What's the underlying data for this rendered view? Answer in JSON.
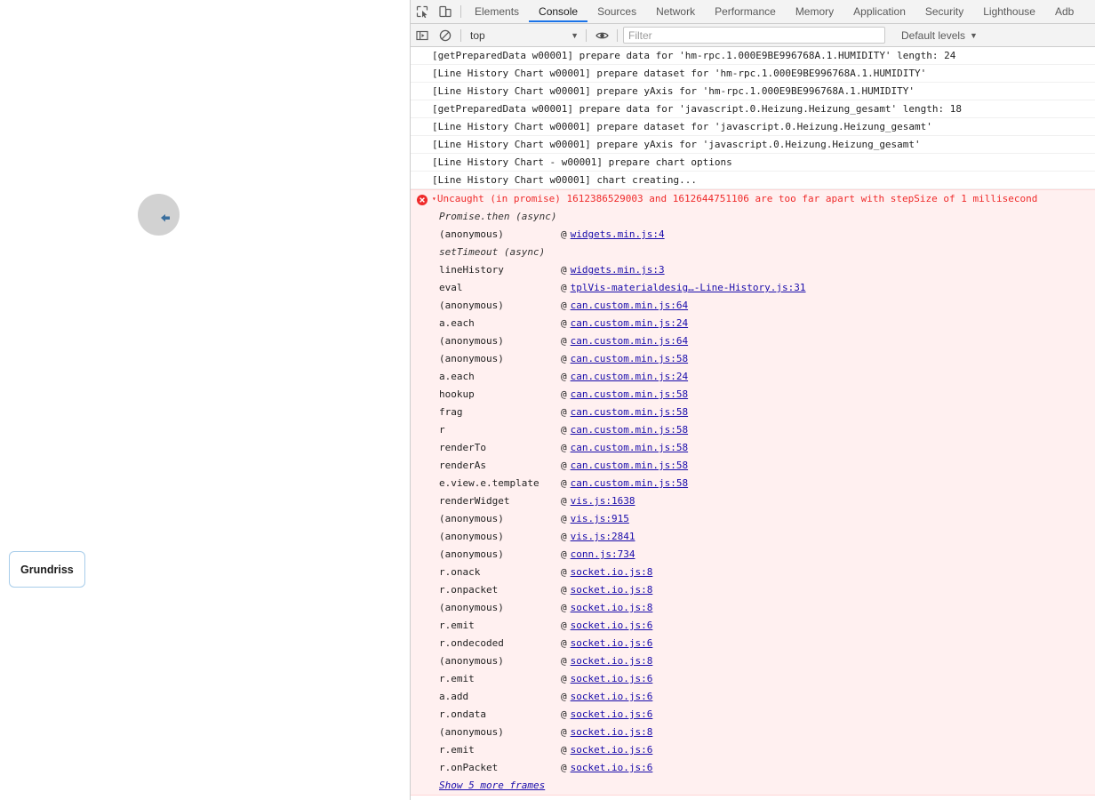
{
  "page": {
    "widget": {
      "circle_label": "",
      "cursor_icon": "cursor-arrow-icon"
    },
    "grundriss_button": "Grundriss"
  },
  "devtools": {
    "toolbar_icons": [
      {
        "name": "inspect-element-icon"
      },
      {
        "name": "device-toolbar-icon"
      }
    ],
    "tabs": [
      {
        "label": "Elements",
        "active": false
      },
      {
        "label": "Console",
        "active": true
      },
      {
        "label": "Sources",
        "active": false
      },
      {
        "label": "Network",
        "active": false
      },
      {
        "label": "Performance",
        "active": false
      },
      {
        "label": "Memory",
        "active": false
      },
      {
        "label": "Application",
        "active": false
      },
      {
        "label": "Security",
        "active": false
      },
      {
        "label": "Lighthouse",
        "active": false
      },
      {
        "label": "Adb",
        "active": false
      }
    ],
    "filterbar": {
      "sidebar_toggle_icon": "console-sidebar-icon",
      "clear_icon": "clear-console-icon",
      "context": "top",
      "context_caret": "▼",
      "eye_icon": "live-expression-eye-icon",
      "filter_placeholder": "Filter",
      "filter_value": "",
      "levels": "Default levels",
      "levels_caret": "▼"
    },
    "console": {
      "logs": [
        "[getPreparedData w00001] prepare data for 'hm-rpc.1.000E9BE996768A.1.HUMIDITY' length: 24",
        "[Line History Chart w00001] prepare dataset for 'hm-rpc.1.000E9BE996768A.1.HUMIDITY'",
        "[Line History Chart w00001] prepare yAxis for 'hm-rpc.1.000E9BE996768A.1.HUMIDITY'",
        "[getPreparedData w00001] prepare data for 'javascript.0.Heizung.Heizung_gesamt' length: 18",
        "[Line History Chart w00001] prepare dataset for 'javascript.0.Heizung.Heizung_gesamt'",
        "[Line History Chart w00001] prepare yAxis for 'javascript.0.Heizung.Heizung_gesamt'",
        "[Line History Chart - w00001] prepare chart options",
        "[Line History Chart w00001] chart creating..."
      ],
      "error": {
        "icon": "error-circle-icon",
        "triangle": "▾",
        "message": "Uncaught (in promise) 1612386529003 and 1612644751106 are too far apart with stepSize of 1 millisecond",
        "stack": [
          {
            "type": "async",
            "fn": "Promise.then (async)"
          },
          {
            "type": "frame",
            "fn": "(anonymous)",
            "at": "@",
            "link": "widgets.min.js:4"
          },
          {
            "type": "async",
            "fn": "setTimeout (async)"
          },
          {
            "type": "frame",
            "fn": "lineHistory",
            "at": "@",
            "link": "widgets.min.js:3"
          },
          {
            "type": "frame",
            "fn": "eval",
            "at": "@",
            "link": "tplVis-materialdesig…-Line-History.js:31"
          },
          {
            "type": "frame",
            "fn": "(anonymous)",
            "at": "@",
            "link": "can.custom.min.js:64"
          },
          {
            "type": "frame",
            "fn": "a.each",
            "at": "@",
            "link": "can.custom.min.js:24"
          },
          {
            "type": "frame",
            "fn": "(anonymous)",
            "at": "@",
            "link": "can.custom.min.js:64"
          },
          {
            "type": "frame",
            "fn": "(anonymous)",
            "at": "@",
            "link": "can.custom.min.js:58"
          },
          {
            "type": "frame",
            "fn": "a.each",
            "at": "@",
            "link": "can.custom.min.js:24"
          },
          {
            "type": "frame",
            "fn": "hookup",
            "at": "@",
            "link": "can.custom.min.js:58"
          },
          {
            "type": "frame",
            "fn": "frag",
            "at": "@",
            "link": "can.custom.min.js:58"
          },
          {
            "type": "frame",
            "fn": "r",
            "at": "@",
            "link": "can.custom.min.js:58"
          },
          {
            "type": "frame",
            "fn": "renderTo",
            "at": "@",
            "link": "can.custom.min.js:58"
          },
          {
            "type": "frame",
            "fn": "renderAs",
            "at": "@",
            "link": "can.custom.min.js:58"
          },
          {
            "type": "frame",
            "fn": "e.view.e.template",
            "at": "@",
            "link": "can.custom.min.js:58"
          },
          {
            "type": "frame",
            "fn": "renderWidget",
            "at": "@",
            "link": "vis.js:1638"
          },
          {
            "type": "frame",
            "fn": "(anonymous)",
            "at": "@",
            "link": "vis.js:915"
          },
          {
            "type": "frame",
            "fn": "(anonymous)",
            "at": "@",
            "link": "vis.js:2841"
          },
          {
            "type": "frame",
            "fn": "(anonymous)",
            "at": "@",
            "link": "conn.js:734"
          },
          {
            "type": "frame",
            "fn": "r.onack",
            "at": "@",
            "link": "socket.io.js:8"
          },
          {
            "type": "frame",
            "fn": "r.onpacket",
            "at": "@",
            "link": "socket.io.js:8"
          },
          {
            "type": "frame",
            "fn": "(anonymous)",
            "at": "@",
            "link": "socket.io.js:8"
          },
          {
            "type": "frame",
            "fn": "r.emit",
            "at": "@",
            "link": "socket.io.js:6"
          },
          {
            "type": "frame",
            "fn": "r.ondecoded",
            "at": "@",
            "link": "socket.io.js:6"
          },
          {
            "type": "frame",
            "fn": "(anonymous)",
            "at": "@",
            "link": "socket.io.js:8"
          },
          {
            "type": "frame",
            "fn": "r.emit",
            "at": "@",
            "link": "socket.io.js:6"
          },
          {
            "type": "frame",
            "fn": "a.add",
            "at": "@",
            "link": "socket.io.js:6"
          },
          {
            "type": "frame",
            "fn": "r.ondata",
            "at": "@",
            "link": "socket.io.js:6"
          },
          {
            "type": "frame",
            "fn": "(anonymous)",
            "at": "@",
            "link": "socket.io.js:8"
          },
          {
            "type": "frame",
            "fn": "r.emit",
            "at": "@",
            "link": "socket.io.js:6"
          },
          {
            "type": "frame",
            "fn": "r.onPacket",
            "at": "@",
            "link": "socket.io.js:6"
          }
        ],
        "more_frames": "Show 5 more frames"
      }
    }
  },
  "colors": {
    "error_text": "#ef2b2b",
    "error_bg": "#fff0f0",
    "link": "#1a0dab",
    "tab_active_underline": "#1a73e8",
    "button_border": "#a8cdea",
    "circle_bg": "#d2d2d2"
  }
}
